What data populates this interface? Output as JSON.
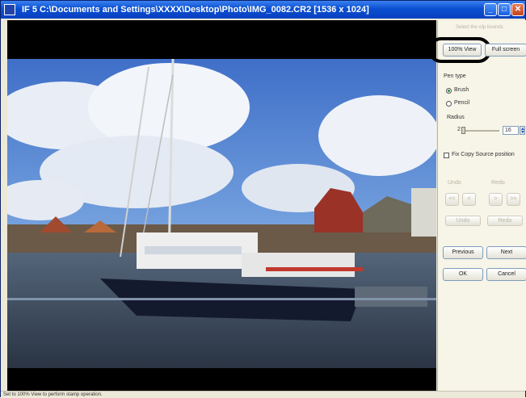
{
  "window": {
    "title": "IF 5 C:\\Documents and Settings\\XXXX\\Desktop\\Photo\\IMG_0082.CR2 [1536 x 1024]",
    "minimize_glyph": "_",
    "maximize_glyph": "□",
    "close_glyph": "✕"
  },
  "panel": {
    "hint_text": "Select the clip bounds",
    "view_100_label": "100% View",
    "full_screen_label": "Full screen",
    "pen_type_label": "Pen type",
    "pen_types": [
      "Brush",
      "Pencil"
    ],
    "radius_label": "Radius",
    "radius_value": "2",
    "radius_max": "16",
    "fix_source_label": "Fix Copy Source position",
    "fix_source_checked": false,
    "undo_label": "Undo",
    "redo_label": "Redo",
    "undo_back_label": "<<",
    "undo_step_label": "<",
    "redo_step_label": ">",
    "redo_fwd_label": ">>",
    "undo_all_label": "Undo",
    "redo_all_label": "Redo",
    "previous_label": "Previous",
    "next_label": "Next",
    "ok_label": "OK",
    "cancel_label": "Cancel"
  },
  "status": {
    "text": "Set to 100% View to perform stamp operation."
  },
  "colors": {
    "title_bar": "#0a4fd1",
    "panel_bg": "#f7f4e8",
    "viewer_bg": "#000000",
    "highlight_ring": "#000000"
  },
  "icons": {
    "app": "app-icon",
    "minimize": "minimize-icon",
    "maximize": "maximize-icon",
    "close": "close-icon"
  }
}
